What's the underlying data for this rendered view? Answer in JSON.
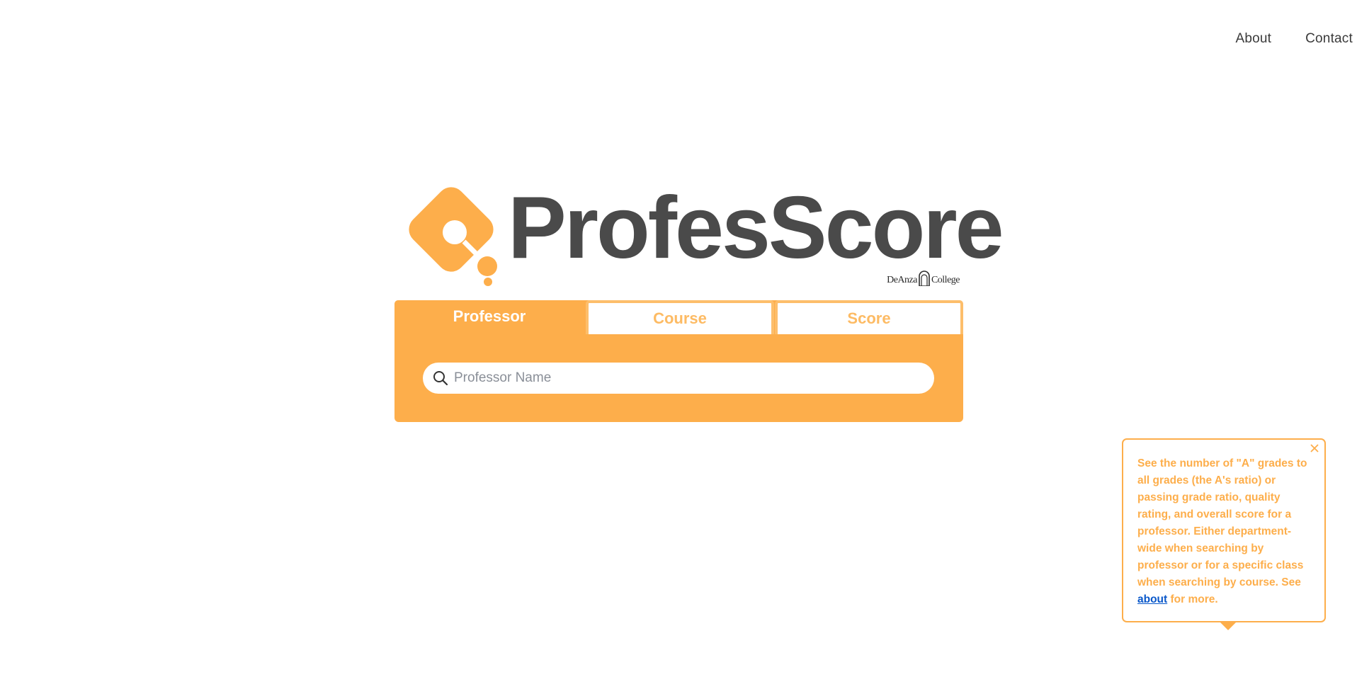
{
  "nav": {
    "about_label": "About",
    "contact_label": "Contact"
  },
  "logo": {
    "text": "ProfesScore",
    "college_left": "DeAnza",
    "college_right": "College"
  },
  "tabs": {
    "professor_label": "Professor",
    "course_label": "Course",
    "score_label": "Score",
    "active": "Professor"
  },
  "search": {
    "placeholder": "Professor Name",
    "value": ""
  },
  "popover": {
    "text_before_link": "See the number of \"A\" grades to all grades (the A's ratio) or passing grade ratio, quality rating, and overall score for a professor. Either department-wide when searching by professor or for a specific class when searching by course. See ",
    "link_label": "about",
    "text_after_link": " for more."
  },
  "colors": {
    "brand_orange": "#fdae4b",
    "logo_gray": "#4a4a4a",
    "link_blue": "#0a58ca"
  },
  "icons": [
    "search-icon",
    "close-icon",
    "logo-mark-icon",
    "college-arch-icon"
  ]
}
